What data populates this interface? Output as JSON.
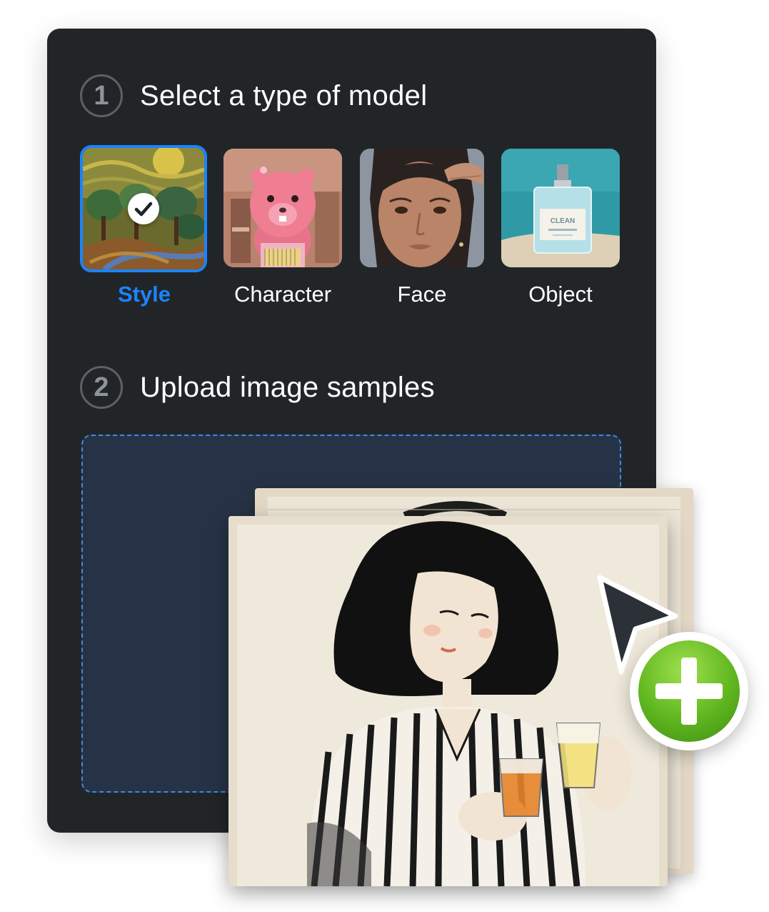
{
  "steps": [
    {
      "number": "1",
      "title": "Select a type of model"
    },
    {
      "number": "2",
      "title": "Upload image samples"
    }
  ],
  "model_types": [
    {
      "label": "Style",
      "selected": true
    },
    {
      "label": "Character",
      "selected": false
    },
    {
      "label": "Face",
      "selected": false
    },
    {
      "label": "Object",
      "selected": false
    }
  ],
  "product_bottle": {
    "brand": "CLEAN"
  },
  "colors": {
    "panel_bg": "#222528",
    "accent": "#1a84ff",
    "dropzone_bg": "#263346",
    "add_button": "#5fb61f"
  },
  "icons": {
    "selected_check": "check-icon",
    "pointer": "cursor-arrow-icon",
    "add": "plus-icon"
  }
}
